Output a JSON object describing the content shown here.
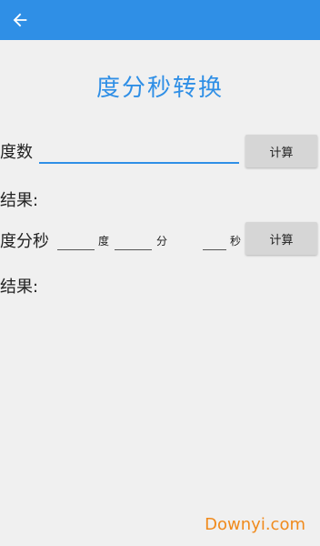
{
  "title": "度分秒转换",
  "decimal": {
    "label": "度数",
    "value": "",
    "button": "计算",
    "result_label": "结果:"
  },
  "dms": {
    "label": "度分秒",
    "deg_unit": "度",
    "min_unit": "分",
    "sec_unit": "秒",
    "button": "计算",
    "result_label": "结果:"
  },
  "watermark": "Downyi.com",
  "colors": {
    "accent": "#2f8fe6",
    "button_bg": "#d6d6d6",
    "watermark": "#f08a1c"
  }
}
